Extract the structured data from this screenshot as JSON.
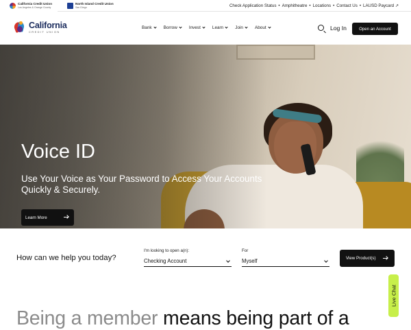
{
  "utility_bar": {
    "brands": [
      {
        "name": "California Credit Union",
        "sub": "Los Angeles & Orange County"
      },
      {
        "name": "North Island Credit Union",
        "sub": "San Diego"
      }
    ],
    "links": [
      "Check Application Status",
      "Amphitheatre",
      "Locations",
      "Contact Us",
      "LAUSD Paycard ↗"
    ],
    "separator": "•"
  },
  "header": {
    "logo_main": "California",
    "logo_sub": "CREDIT UNION",
    "nav": [
      "Bank",
      "Borrow",
      "Invest",
      "Learn",
      "Join",
      "About"
    ],
    "login": "Log In",
    "open_account": "Open an Account"
  },
  "hero": {
    "title": "Voice ID",
    "subtitle": "Use Your Voice as Your Password to Access Your Accounts Quickly & Securely.",
    "cta": "Learn More",
    "slide_count": 7,
    "active_slide": 2
  },
  "help": {
    "question": "How can we help you today?",
    "open_label": "I'm looking to open a(n):",
    "open_value": "Checking Account",
    "for_label": "For",
    "for_value": "Myself",
    "button": "View Product(s)"
  },
  "live_chat": "Live Chat",
  "tagline": {
    "muted": "Being a member ",
    "bold": "means being part of a"
  }
}
